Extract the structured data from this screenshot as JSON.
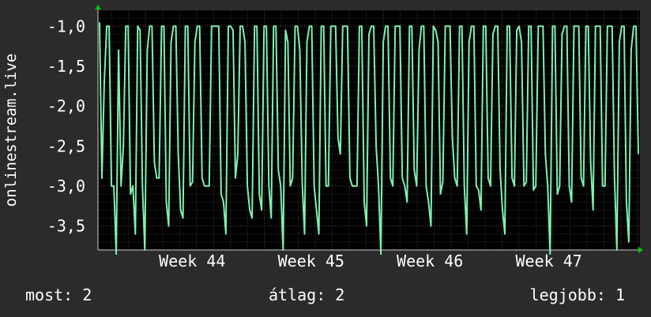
{
  "chart_data": {
    "type": "line",
    "title": "",
    "ylabel": "onlinestream.live",
    "xlabel": "",
    "ylim": [
      -3.8,
      -0.8
    ],
    "yticks": [
      {
        "value": -1.0,
        "label": "-1,0"
      },
      {
        "value": -1.5,
        "label": "-1,5"
      },
      {
        "value": -2.0,
        "label": "-2,0"
      },
      {
        "value": -2.5,
        "label": "-2,5"
      },
      {
        "value": -3.0,
        "label": "-3,0"
      },
      {
        "value": -3.5,
        "label": "-3,5"
      }
    ],
    "x_range_weeks": [
      43.6,
      48.16
    ],
    "xticks": [
      {
        "value": 44,
        "label": "Week 44"
      },
      {
        "value": 45,
        "label": "Week 45"
      },
      {
        "value": 46,
        "label": "Week 46"
      },
      {
        "value": 47,
        "label": "Week 47"
      },
      {
        "value": 48,
        "label": ""
      }
    ],
    "grid": true,
    "colors": {
      "background": "#2b2b2b",
      "plot_background": "#000000",
      "line": "#7ff0b0",
      "grid": "#3a3a3a",
      "axis_arrow": "#00cc00"
    },
    "series": [
      {
        "values": [
          -0.95,
          -2.9,
          -1.7,
          -1.0,
          -1.0,
          -3.0,
          -3.0,
          -3.85,
          -1.3,
          -3.0,
          -2.5,
          -1.0,
          -1.0,
          -3.1,
          -3.0,
          -3.6,
          -1.0,
          -1.05,
          -3.0,
          -3.8,
          -1.3,
          -1.0,
          -1.0,
          -2.7,
          -2.9,
          -2.9,
          -1.0,
          -1.0,
          -3.2,
          -3.5,
          -1.2,
          -1.0,
          -1.0,
          -2.6,
          -3.3,
          -3.4,
          -1.0,
          -1.0,
          -3.0,
          -2.95,
          -1.2,
          -1.0,
          -1.0,
          -2.9,
          -3.0,
          -3.0,
          -3.0,
          -1.0,
          -1.0,
          -1.0,
          -1.0,
          -3.1,
          -3.2,
          -3.6,
          -1.0,
          -1.0,
          -1.05,
          -2.9,
          -2.6,
          -1.0,
          -1.0,
          -1.2,
          -3.0,
          -3.3,
          -3.4,
          -1.0,
          -1.0,
          -3.1,
          -3.3,
          -1.0,
          -1.0,
          -3.0,
          -3.4,
          -1.0,
          -1.0,
          -2.8,
          -3.0,
          -3.8,
          -1.05,
          -1.2,
          -3.0,
          -2.9,
          -1.0,
          -1.0,
          -1.3,
          -2.95,
          -3.6,
          -1.2,
          -1.0,
          -1.0,
          -3.0,
          -3.3,
          -3.6,
          -1.0,
          -1.0,
          -3.0,
          -3.0,
          -1.0,
          -1.0,
          -1.0,
          -2.4,
          -2.6,
          -1.0,
          -1.0,
          -1.0,
          -2.9,
          -3.0,
          -3.0,
          -3.0,
          -1.0,
          -1.0,
          -3.2,
          -3.5,
          -1.1,
          -1.0,
          -1.0,
          -2.5,
          -3.0,
          -3.85,
          -1.2,
          -1.0,
          -1.0,
          -2.9,
          -3.0,
          -1.0,
          -1.0,
          -1.0,
          -2.9,
          -3.0,
          -3.2,
          -1.0,
          -1.0,
          -2.8,
          -3.0,
          -1.3,
          -1.0,
          -1.0,
          -3.0,
          -3.2,
          -3.5,
          -1.0,
          -1.05,
          -1.2,
          -3.1,
          -2.95,
          -1.0,
          -1.0,
          -1.0,
          -2.4,
          -2.9,
          -3.0,
          -1.0,
          -1.0,
          -3.0,
          -3.6,
          -1.2,
          -1.0,
          -1.0,
          -3.0,
          -3.05,
          -3.3,
          -1.0,
          -1.0,
          -2.9,
          -3.0,
          -1.1,
          -1.0,
          -1.0,
          -2.8,
          -3.3,
          -3.6,
          -1.0,
          -1.0,
          -2.9,
          -3.0,
          -1.05,
          -1.0,
          -1.2,
          -3.0,
          -2.95,
          -1.0,
          -1.0,
          -3.05,
          -3.0,
          -1.0,
          -1.0,
          -1.0,
          -2.6,
          -3.0,
          -3.85,
          -1.0,
          -1.0,
          -3.1,
          -3.0,
          -1.1,
          -1.0,
          -1.0,
          -3.0,
          -3.2,
          -1.0,
          -1.0,
          -1.0,
          -2.9,
          -3.0,
          -1.0,
          -1.0,
          -2.7,
          -3.3,
          -1.0,
          -1.0,
          -1.0,
          -3.0,
          -3.0,
          -1.0,
          -1.0,
          -1.0,
          -2.9,
          -3.8,
          -1.2,
          -1.0,
          -1.0,
          -3.2,
          -3.7,
          -1.3,
          -1.0,
          -1.0,
          -2.6
        ]
      }
    ]
  },
  "stats": {
    "current": "most: 2",
    "average": "átlag: 2",
    "best": "legjobb: 1"
  }
}
